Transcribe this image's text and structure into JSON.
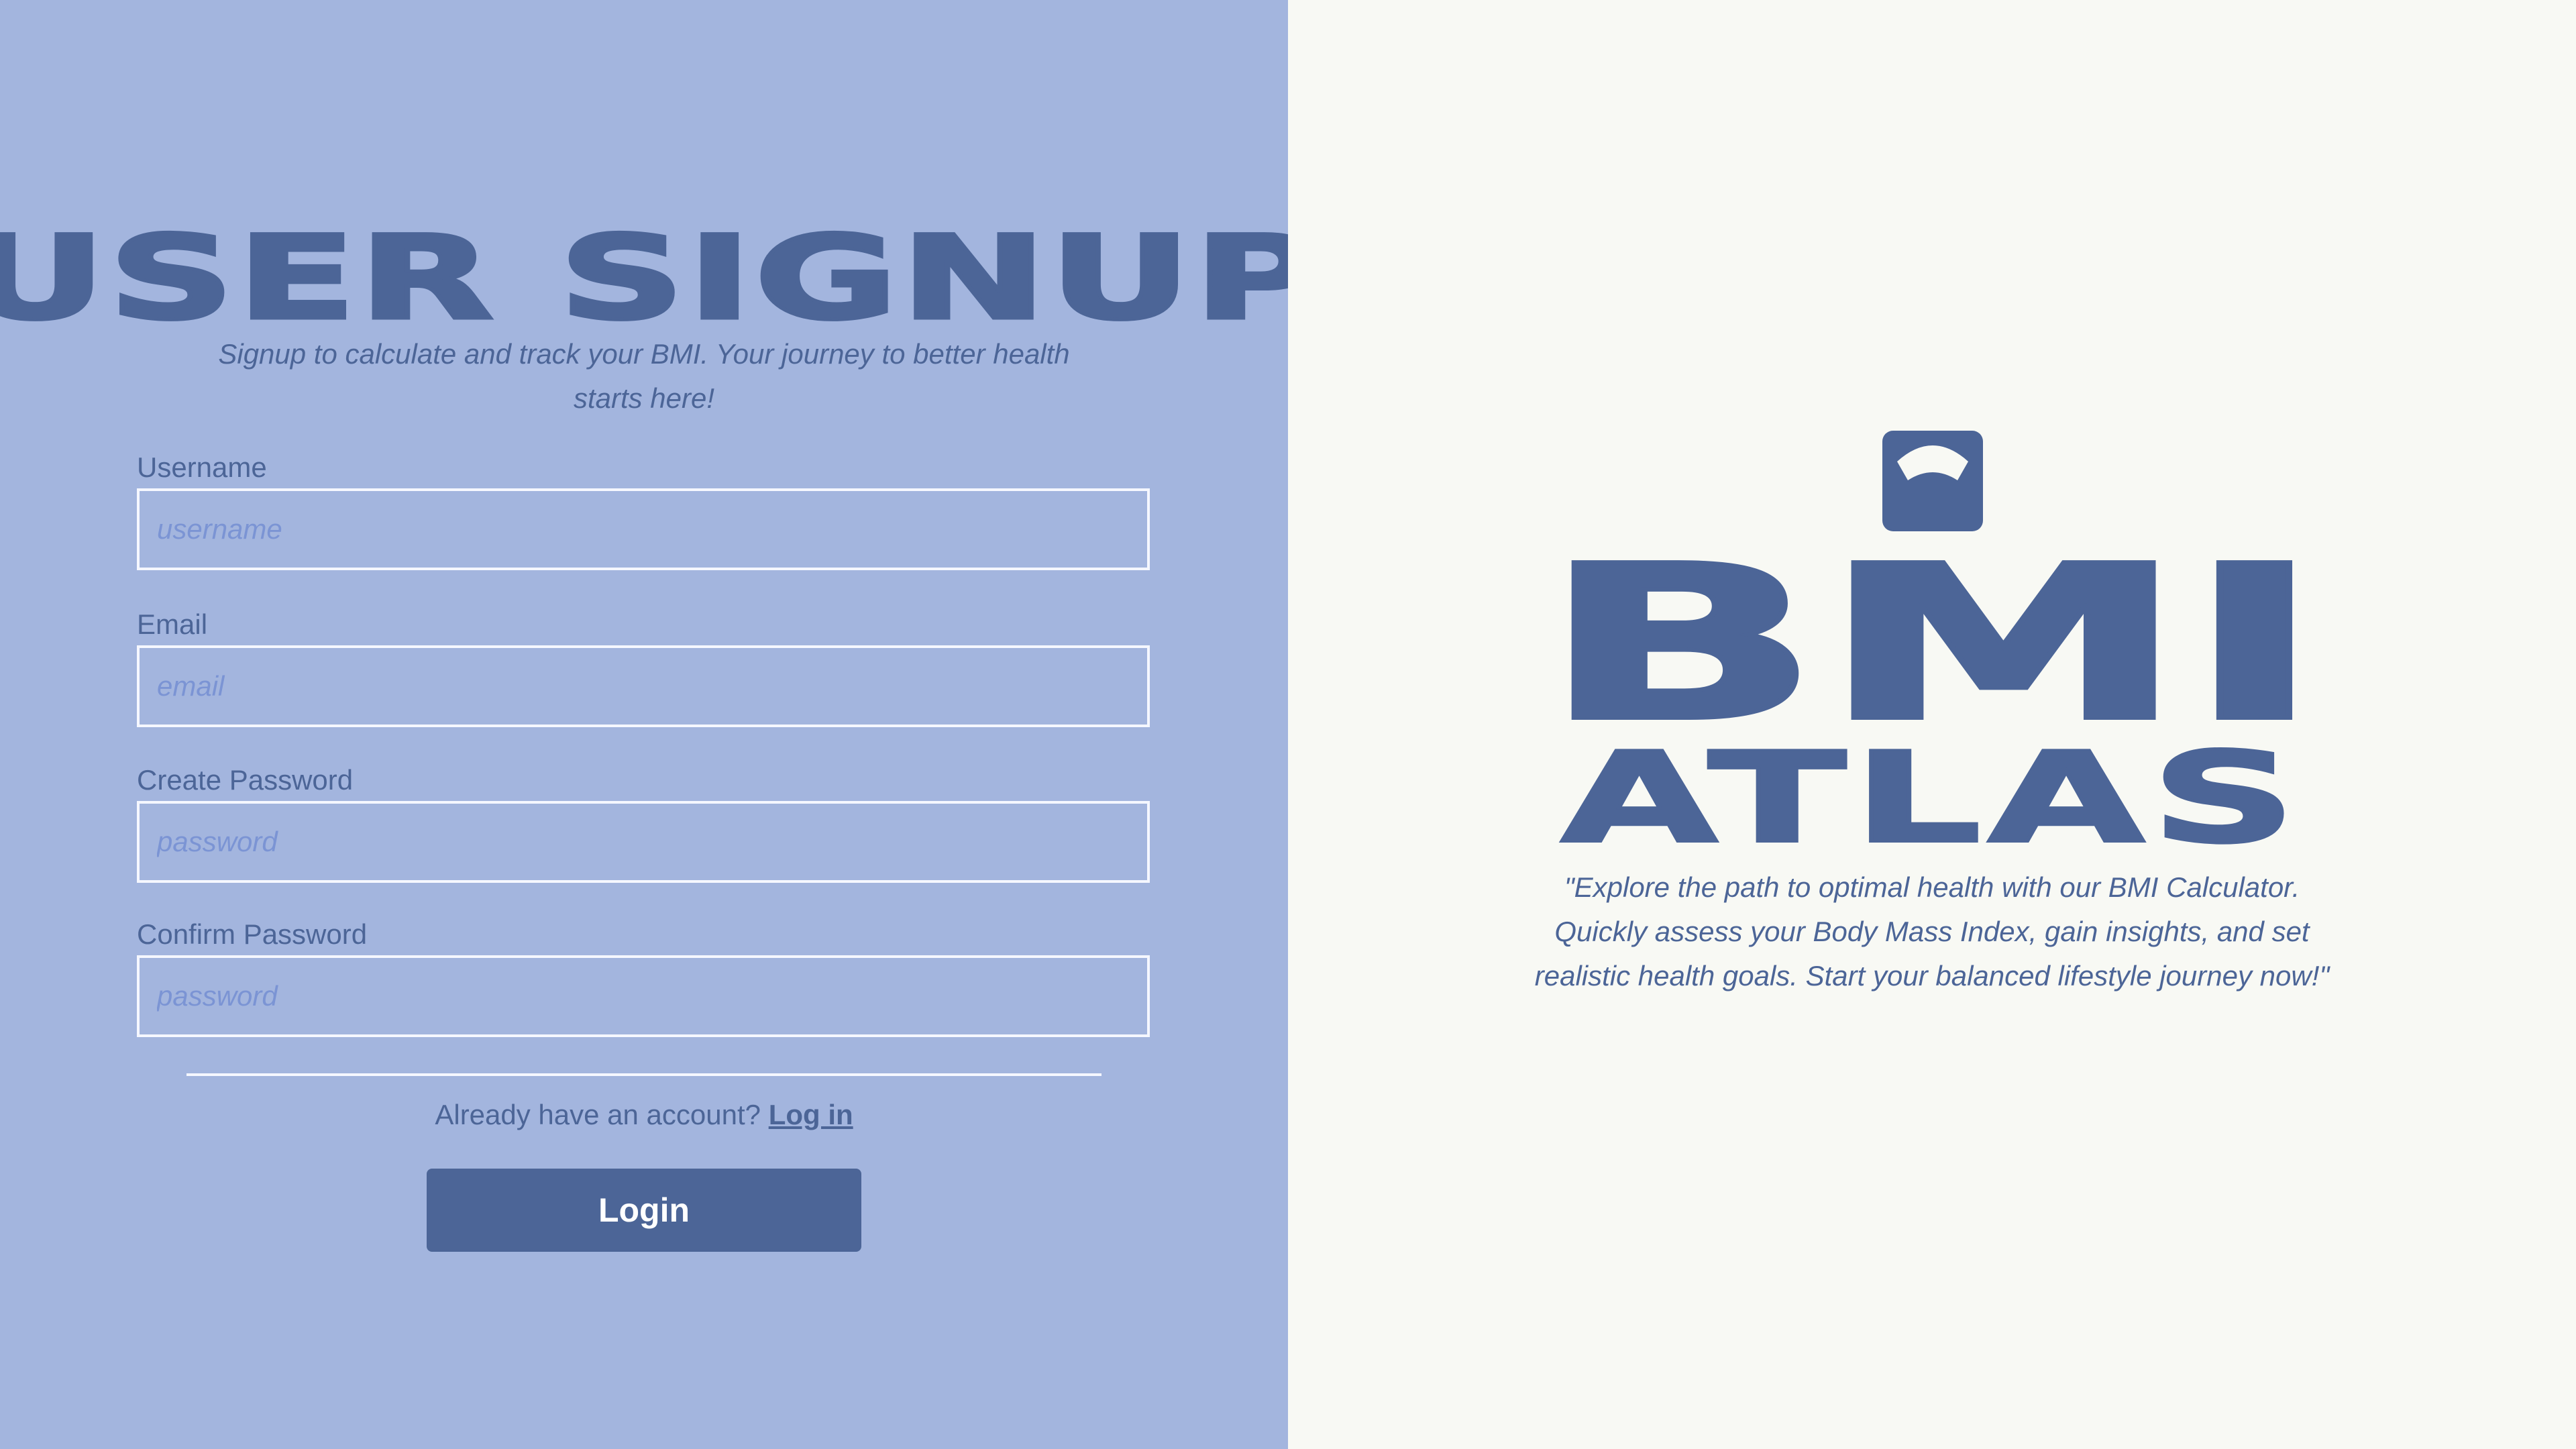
{
  "colors": {
    "left_panel_bg": "#a3b5de",
    "right_panel_bg": "#f8f9f4",
    "brand": "#4c6597",
    "input_border": "#f5f7ff",
    "placeholder": "#7b94d4",
    "button_text": "#ffffff"
  },
  "signup": {
    "title": "USER SIGNUP",
    "subtitle": "Signup to calculate and track your BMI. Your journey to better health starts here!",
    "fields": [
      {
        "label": "Username",
        "placeholder": "username",
        "value": ""
      },
      {
        "label": "Email",
        "placeholder": "email",
        "value": ""
      },
      {
        "label": "Create Password",
        "placeholder": "password",
        "value": ""
      },
      {
        "label": "Confirm Password",
        "placeholder": "password",
        "value": ""
      }
    ],
    "account_prompt": "Already have an account?",
    "login_link": "Log in",
    "login_button": "Login"
  },
  "brand": {
    "icon": "bathroom-scale-icon",
    "line1": "BMI",
    "line2": "ATLAS",
    "tagline": "\"Explore the path to optimal health with our BMI Calculator. Quickly assess your Body Mass Index, gain insights, and set realistic health goals. Start your balanced lifestyle journey now!\""
  }
}
